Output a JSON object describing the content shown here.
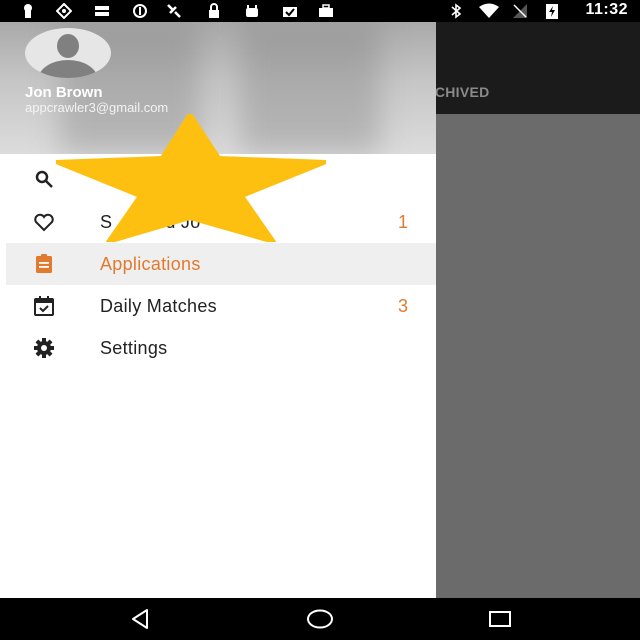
{
  "status_bar": {
    "time": "11:32",
    "icons": [
      "keyhole-icon",
      "vpn-icon",
      "storage-icon",
      "info-circle-icon",
      "satellite-icon",
      "lock-icon",
      "android-icon",
      "clipboard-check-icon",
      "briefcase-icon",
      "bluetooth-icon",
      "wifi-icon",
      "no-signal-icon",
      "battery-charging-icon"
    ]
  },
  "background": {
    "tab_label": "ARCHIVED"
  },
  "drawer": {
    "user": {
      "name": "Jon Brown",
      "email": "appcrawler3@gmail.com"
    },
    "items": [
      {
        "icon": "search-icon",
        "label": "",
        "count": ""
      },
      {
        "icon": "heart-icon",
        "label": "Saved Jobs",
        "label_visible": "S          d Jo",
        "count": "1"
      },
      {
        "icon": "clipboard-icon",
        "label": "Applications",
        "count": "",
        "active": true
      },
      {
        "icon": "calendar-check-icon",
        "label": "Daily Matches",
        "count": "3"
      },
      {
        "icon": "gear-icon",
        "label": "Settings",
        "count": ""
      }
    ]
  },
  "colors": {
    "accent": "#e07a2f",
    "star": "#fdc010",
    "status_bar": "#000000",
    "scrim": "#6b6b6b"
  },
  "nav": {
    "buttons": [
      "back-icon",
      "home-icon",
      "recents-icon"
    ]
  }
}
